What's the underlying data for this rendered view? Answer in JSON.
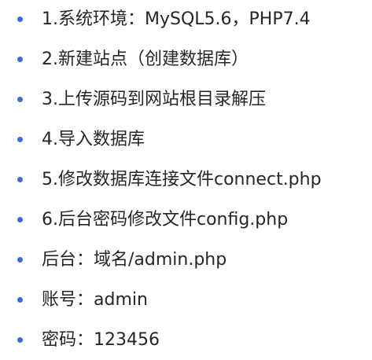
{
  "list": {
    "items": [
      {
        "text": "1.系统环境：MySQL5.6，PHP7.4"
      },
      {
        "text": "2.新建站点（创建数据库）"
      },
      {
        "text": "3.上传源码到网站根目录解压"
      },
      {
        "text": "4.导入数据库"
      },
      {
        "text": "5.修改数据库连接文件connect.php"
      },
      {
        "text": "6.后台密码修改文件config.php"
      },
      {
        "text": "后台：域名/admin.php"
      },
      {
        "text": "账号：admin"
      },
      {
        "text": "密码：123456"
      }
    ],
    "bullet_color": "#3d6ad6",
    "text_color": "#262626"
  }
}
